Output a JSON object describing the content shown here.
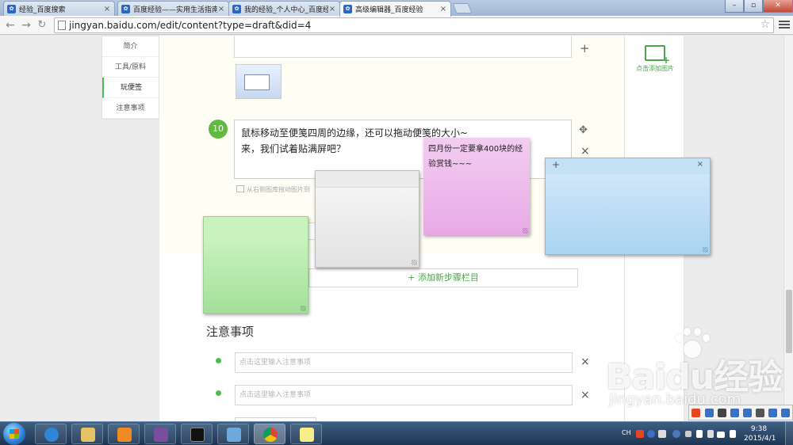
{
  "browser": {
    "tabs": [
      {
        "title": "经验_百度搜索",
        "active": false
      },
      {
        "title": "百度经验——实用生活指南",
        "active": false
      },
      {
        "title": "我的经验_个人中心_百度经验",
        "active": false
      },
      {
        "title": "高级编辑器_百度经验",
        "active": true
      }
    ],
    "url": "jingyan.baidu.com/edit/content?type=draft&did=4"
  },
  "leftnav": {
    "items": [
      "简介",
      "工具/原料",
      "玩便签",
      "注意事项"
    ],
    "active_index": 2
  },
  "rightpanel": {
    "add_image_label": "点击添加图片"
  },
  "step": {
    "number": "10",
    "line1": "鼠标移动至便笺四周的边缘，还可以拖动便笺的大小~",
    "line2": "来，我们试着贴满屏吧？",
    "hint": "从右侧图库拖动图片到"
  },
  "add_step_label": "+ 添加新步骤栏目",
  "notes": {
    "title": "注意事项",
    "placeholder": "点击这里输入注意事项"
  },
  "stickies": {
    "pink_text": "四月份一定要拿400块的经验赏钱~~~",
    "blue_add": "+",
    "blue_close": "×"
  },
  "watermark": {
    "logo": "Baidu经验",
    "url": "jingyan.baidu.com"
  },
  "taskbar": {
    "lang": "CH",
    "time": "9:38",
    "date": "2015/4/1"
  },
  "icons": {
    "back": "←",
    "forward": "→",
    "close": "×",
    "plus": "+",
    "move": "✥",
    "star": "☆"
  },
  "colors": {
    "accent_green": "#4dbd4d",
    "step_badge": "#5fba3f"
  }
}
